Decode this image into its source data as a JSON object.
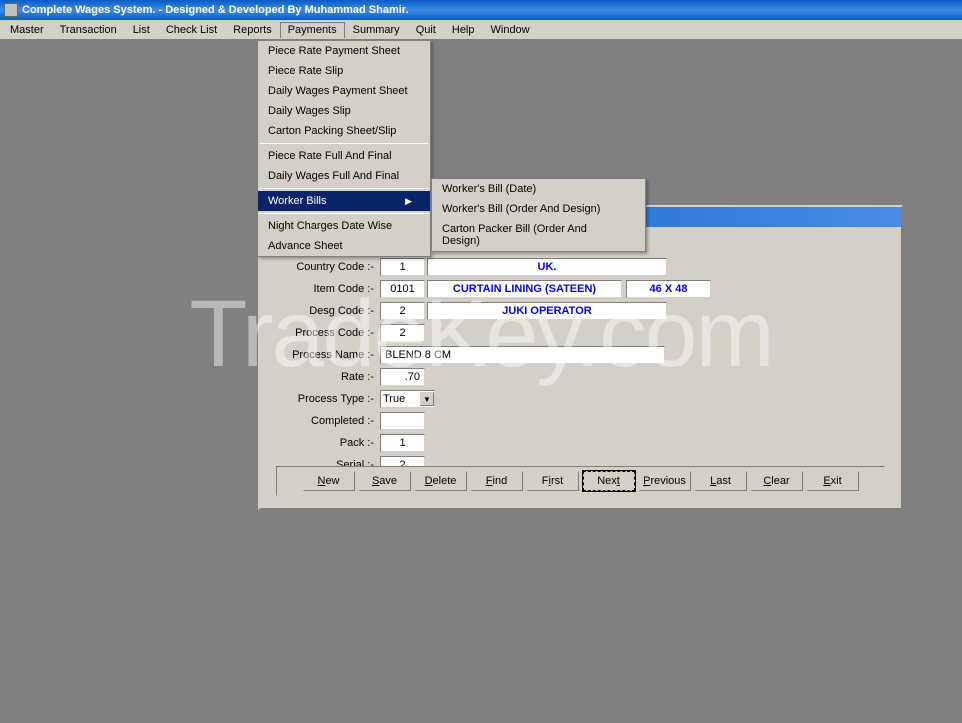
{
  "title": "Complete Wages System. - Designed & Developed By Muhammad Shamir.",
  "menubar": {
    "items": [
      "Master",
      "Transaction",
      "List",
      "Check List",
      "Reports",
      "Payments",
      "Summary",
      "Quit",
      "Help",
      "Window"
    ],
    "active": "Payments"
  },
  "payments_menu": {
    "group1": [
      "Piece Rate Payment Sheet",
      "Piece Rate Slip",
      "Daily Wages Payment Sheet",
      "Daily Wages Slip",
      "Carton Packing Sheet/Slip"
    ],
    "group2": [
      "Piece Rate Full And Final",
      "Daily Wages Full And Final"
    ],
    "worker_bills": "Worker Bills",
    "group3": [
      "Night Charges Date Wise",
      "Advance Sheet"
    ]
  },
  "worker_bills_submenu": [
    "Worker's Bill (Date)",
    "Worker's Bill (Order And Design)",
    "Carton Packer Bill (Order And Design)"
  ],
  "form": {
    "labels": {
      "country": "Country Code :-",
      "item": "Item Code :-",
      "desg": "Desg Code :-",
      "process_code": "Process Code :-",
      "process_name": "Process Name :-",
      "rate": "Rate :-",
      "process_type": "Process Type :-",
      "completed": "Completed :-",
      "pack": "Pack :-",
      "serial": "Serial :-"
    },
    "values": {
      "country_code": "1",
      "country_name": "UK.",
      "item_code": "0101",
      "item_name": "CURTAIN LINING (SATEEN)",
      "item_size": "46 X 48",
      "desg_code": "2",
      "desg_name": "JUKI OPERATOR",
      "process_code": "2",
      "process_name": "BLEND 8 CM",
      "rate": ".70",
      "process_type": "True",
      "completed": "",
      "pack": "1",
      "serial": "2"
    }
  },
  "buttons": {
    "new": "New",
    "save": "Save",
    "delete": "Delete",
    "find": "Find",
    "first": "First",
    "next": "Next",
    "previous": "Previous",
    "last": "Last",
    "clear": "Clear",
    "exit": "Exit"
  },
  "watermark": "TradeKey.com"
}
